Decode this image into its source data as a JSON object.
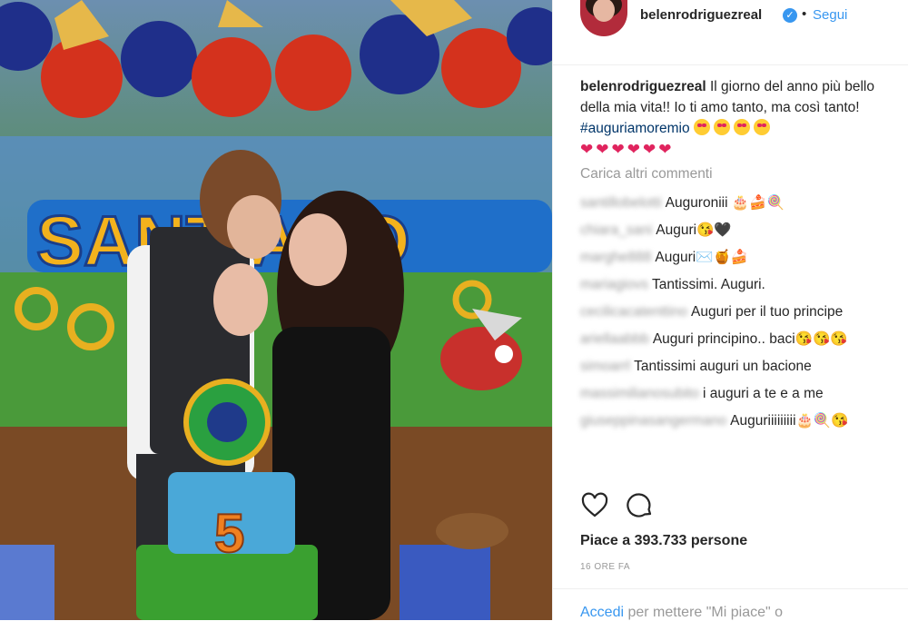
{
  "post": {
    "username": "belenrodriguezreal",
    "follow_dot": "•",
    "follow_label": "Segui",
    "caption": {
      "username": "belenrodriguezreal",
      "text": "Il giorno del anno più bello della mia vita!! Io ti amo tanto, ma così tanto!",
      "hashtag": "#auguriamoremio"
    },
    "load_more_label": "Carica altri commenti",
    "comments": [
      {
        "user": "santillobelotti",
        "text": "Auguroniii 🎂🍰🍭"
      },
      {
        "user": "chiara_sani",
        "text": "Auguri😘🖤"
      },
      {
        "user": "marghe888",
        "text": "Auguri✉️🍯🍰"
      },
      {
        "user": "mariagiovs",
        "text": "Tantissimi. Auguri."
      },
      {
        "user": "cecilicacatenttino",
        "text": "Auguri per il tuo principe"
      },
      {
        "user": "ariellaabbb",
        "text": "Auguri principino.. baci😘😘😘"
      },
      {
        "user": "simoarrl",
        "text": "Tantissimi auguri un bacione"
      },
      {
        "user": "massimilianosubito",
        "text": "i auguri a te e a me"
      },
      {
        "user": "giuseppinasangermano",
        "text": "Auguriiiiiiiii🎂🍭😘"
      }
    ],
    "likes_text": "Piace a 393.733 persone",
    "time_ago": "16 ORE FA",
    "login_link": "Accedi",
    "login_rest": "per mettere \"Mi piace\" o"
  },
  "photo": {
    "sign_text": "SANTIAGO",
    "cake_number": "5"
  },
  "icons": {
    "like": "heart-icon",
    "comment": "comment-icon",
    "verified": "verified-badge-icon"
  },
  "colors": {
    "link": "#3897f0",
    "hashtag": "#003569",
    "text": "#262626",
    "muted": "#999999"
  }
}
